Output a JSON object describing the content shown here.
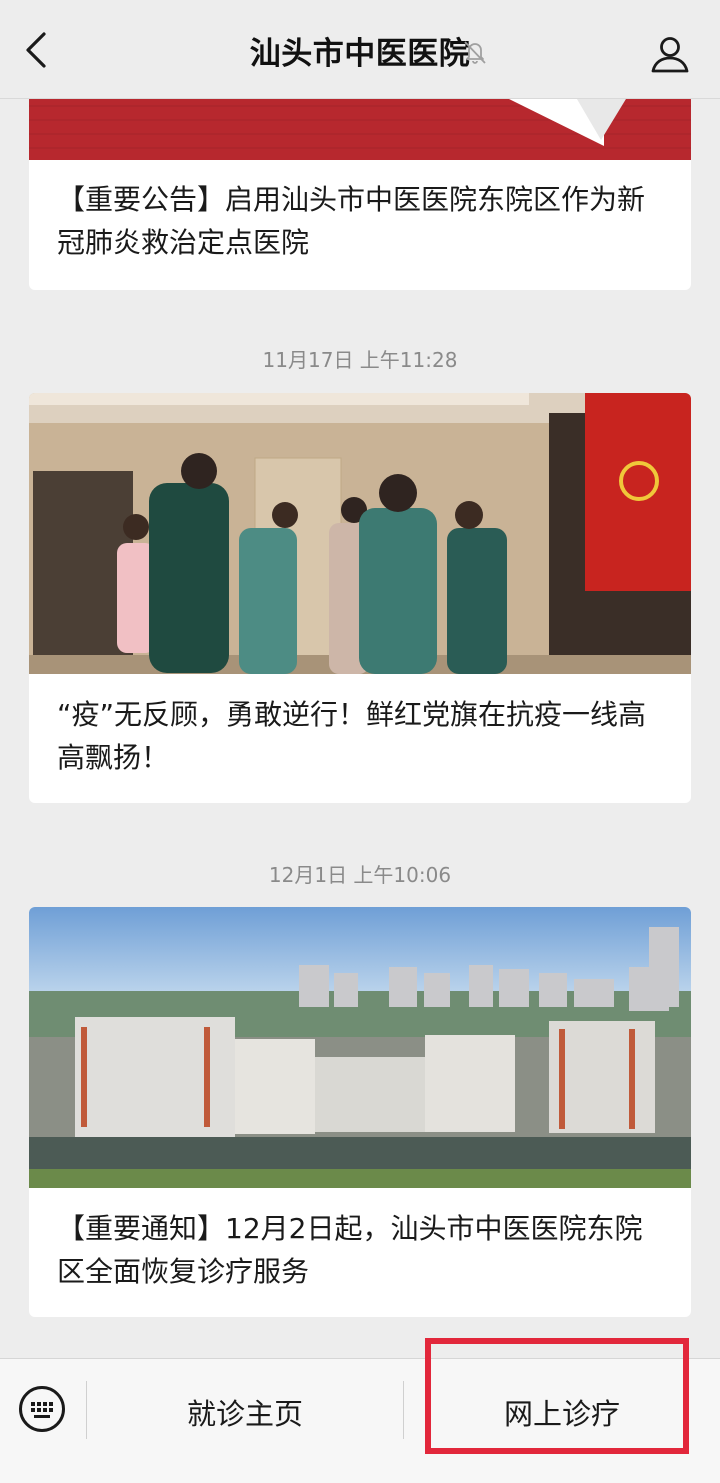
{
  "header": {
    "title": "汕头市中医医院"
  },
  "feed": {
    "items": [
      {
        "title": "【重要公告】启用汕头市中医医院东院区作为新冠肺炎救治定点医院"
      },
      {
        "time": "11月17日 上午11:28",
        "title": "“疫”无反顾，勇敢逆行！鲜红党旗在抗疫一线高高飘扬！"
      },
      {
        "time": "12月1日 上午10:06",
        "title": "【重要通知】12月2日起，汕头市中医医院东院区全面恢复诊疗服务"
      }
    ]
  },
  "bottom_menu": {
    "items": [
      {
        "label": "就诊主页"
      },
      {
        "label": "网上诊疗"
      }
    ]
  },
  "colors": {
    "accent_red": "#e2273b",
    "banner_red": "#b7282e"
  }
}
